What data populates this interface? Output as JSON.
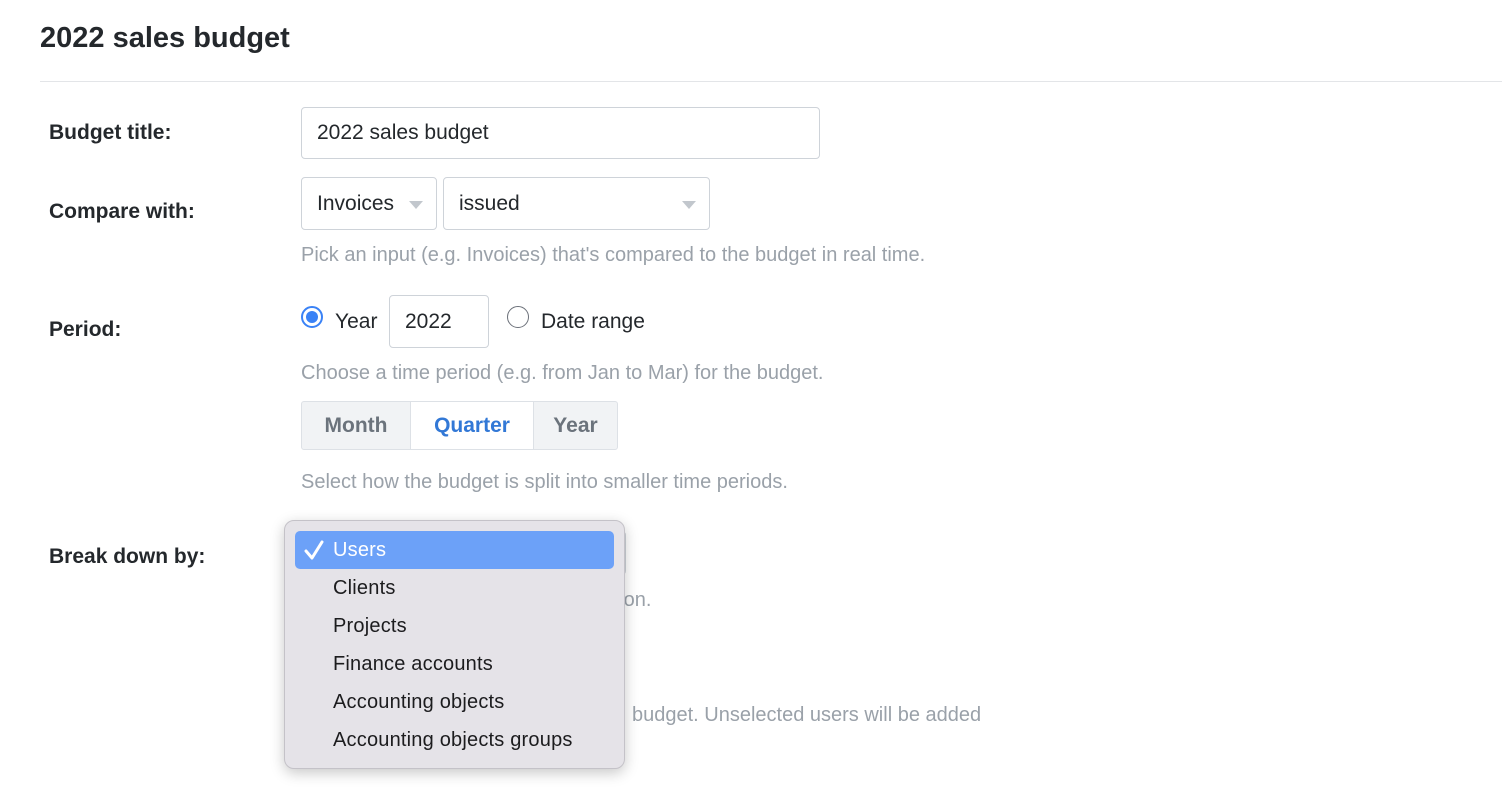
{
  "page": {
    "title": "2022 sales budget"
  },
  "budget_title": {
    "label": "Budget title:",
    "value": "2022 sales budget"
  },
  "compare_with": {
    "label": "Compare with:",
    "source_value": "Invoices",
    "status_value": "issued",
    "hint": "Pick an input (e.g. Invoices) that's compared to the budget in real time."
  },
  "period": {
    "label": "Period:",
    "year_option": "Year",
    "year_value": "2022",
    "date_range_option": "Date range",
    "selected": "Year",
    "hint": "Choose a time period (e.g. from Jan to Mar) for the budget.",
    "split_options": [
      "Month",
      "Quarter",
      "Year"
    ],
    "split_selected": "Quarter",
    "split_hint": "Select how the budget is split into smaller time periods."
  },
  "break_down": {
    "label": "Break down by:",
    "hint_fragment": "d on.",
    "users_hint_fragment": "budget. Unselected users will be added",
    "options": [
      "Users",
      "Clients",
      "Projects",
      "Finance accounts",
      "Accounting objects",
      "Accounting objects groups"
    ],
    "selected": "Users"
  },
  "colors": {
    "accent": "#3a82f6",
    "segment_active": "#3278d6",
    "dropdown_highlight": "#6ca1f8",
    "hint_text": "#9aa1a9"
  }
}
